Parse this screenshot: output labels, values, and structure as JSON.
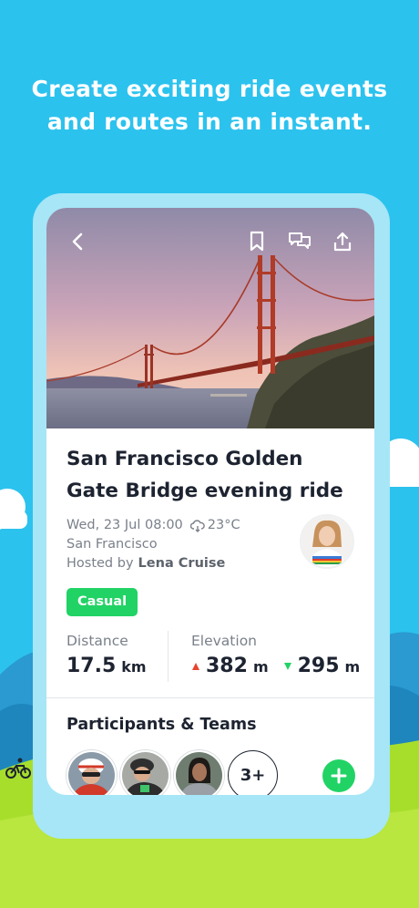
{
  "headline": {
    "line1": "Create exciting ride events",
    "line2": "and routes in an instant."
  },
  "header_icons": {
    "back": "chevron-left-icon",
    "bookmark": "bookmark-icon",
    "chat": "chat-bubbles-icon",
    "share": "share-icon"
  },
  "event": {
    "title": "San Francisco Golden Gate Bridge evening ride",
    "datetime": "Wed, 23 Jul 08:00",
    "temperature": "23°C",
    "location": "San Francisco",
    "hosted_by_label": "Hosted by",
    "host_name": "Lena Cruise",
    "tag": "Casual"
  },
  "stats": {
    "distance_label": "Distance",
    "distance_value": "17.5",
    "distance_unit": "km",
    "elevation_label": "Elevation",
    "elevation_up_value": "382",
    "elevation_up_unit": "m",
    "elevation_down_value": "295",
    "elevation_down_unit": "m"
  },
  "participants": {
    "title": "Participants & Teams",
    "more_label": "3+"
  },
  "colors": {
    "sky": "#2cc2ee",
    "grass": "#a7de2c",
    "accent_green": "#21d365",
    "up_arrow": "#e8442c",
    "down_arrow": "#21d365"
  }
}
